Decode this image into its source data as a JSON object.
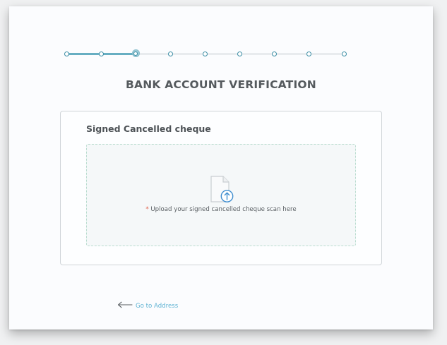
{
  "stepper": {
    "total_steps": 9,
    "current_step": 3,
    "progress_fraction": 0.25
  },
  "header": {
    "title": "BANK ACCOUNT VERIFICATION"
  },
  "upload_section": {
    "label": "Signed Cancelled cheque",
    "required_marker": "*",
    "instruction": " Upload your signed cancelled cheque scan here",
    "icon": "file-upload-icon"
  },
  "footer": {
    "back_icon": "left-arrow-icon",
    "back_label": "Go to Address"
  },
  "colors": {
    "accent": "#67aec2",
    "link": "#5fb3d3",
    "required": "#e0604a",
    "upload_icon": "#3f8ed0"
  }
}
